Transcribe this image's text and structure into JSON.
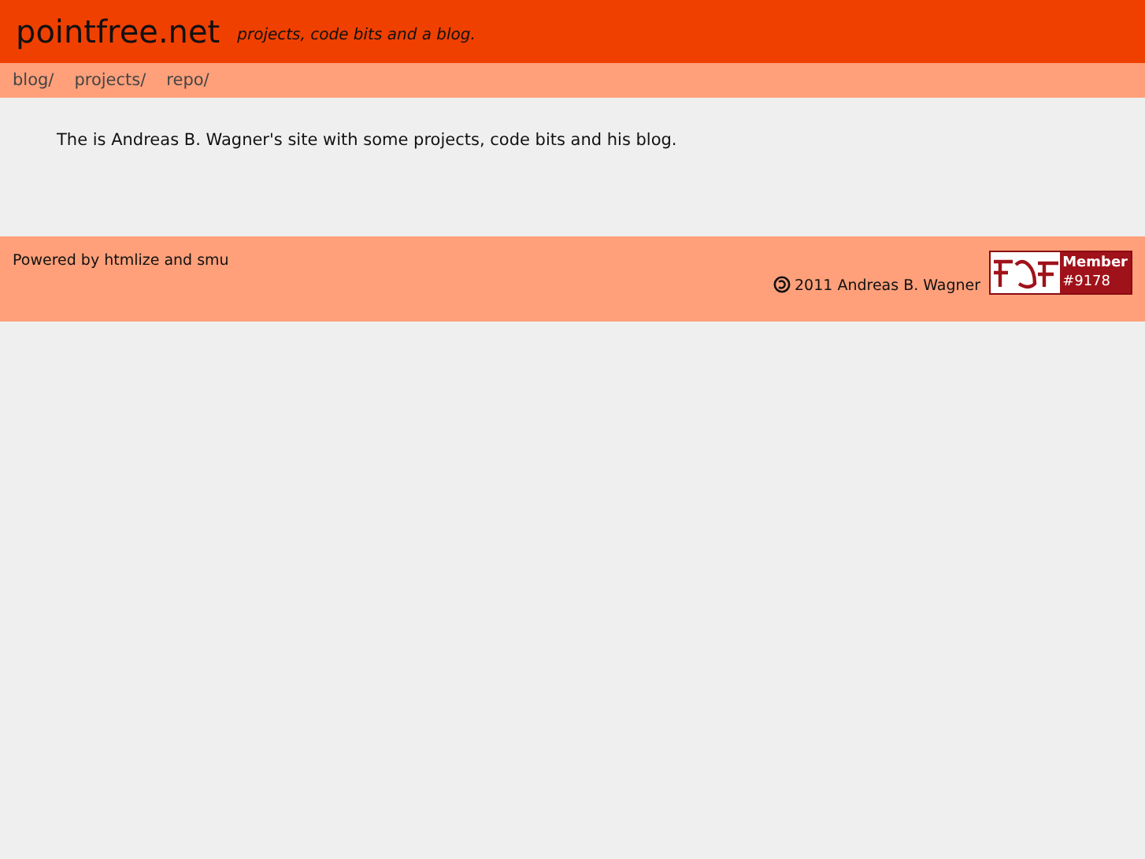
{
  "header": {
    "title": "pointfree.net",
    "tagline": "projects, code bits and a blog."
  },
  "nav": [
    "blog/",
    "projects/",
    "repo/"
  ],
  "intro": "The is Andreas B. Wagner's site with some projects, code bits and his blog.",
  "footer": {
    "powered": "Powered by htmlize and smu",
    "copyright": "2011 Andreas B. Wagner",
    "badge": {
      "line1": "Member",
      "line2": "#9178"
    }
  }
}
